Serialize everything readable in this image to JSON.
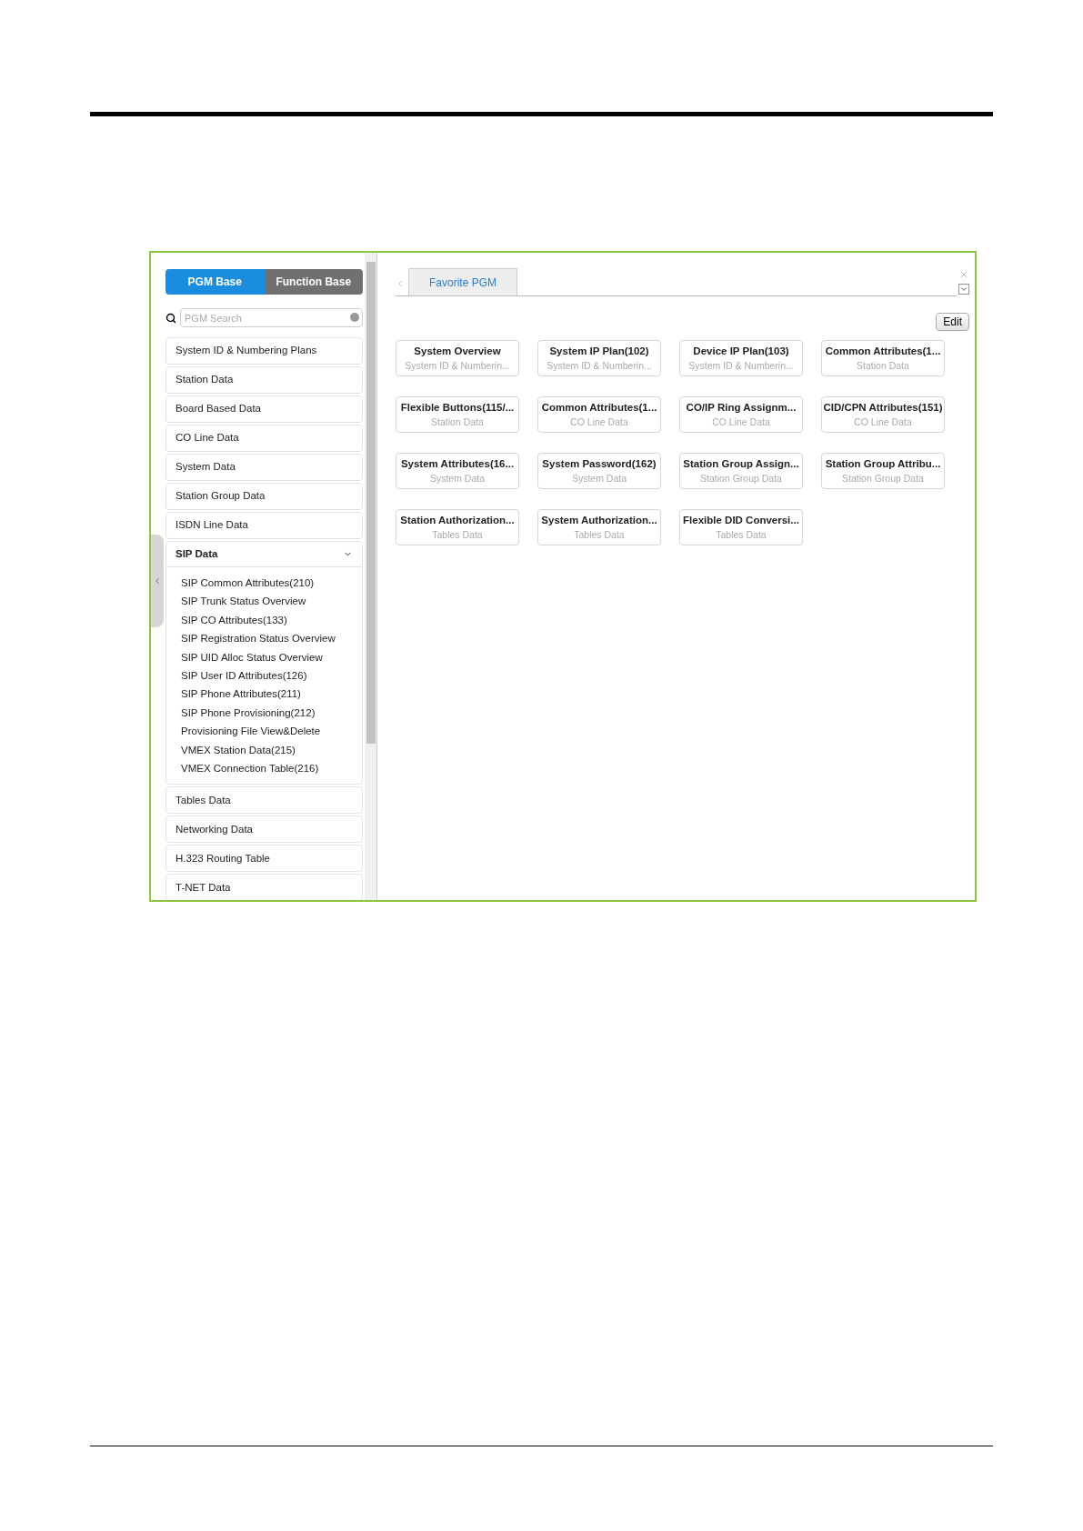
{
  "sidebar": {
    "mode_tabs": [
      {
        "label": "PGM Base",
        "selected": true
      },
      {
        "label": "Function Base",
        "selected": false
      }
    ],
    "search": {
      "placeholder": "PGM Search"
    },
    "items": [
      {
        "label": "System ID & Numbering Plans",
        "expanded": false
      },
      {
        "label": "Station Data",
        "expanded": false
      },
      {
        "label": "Board Based Data",
        "expanded": false
      },
      {
        "label": "CO Line Data",
        "expanded": false
      },
      {
        "label": "System Data",
        "expanded": false
      },
      {
        "label": "Station Group Data",
        "expanded": false
      },
      {
        "label": "ISDN Line Data",
        "expanded": false
      },
      {
        "label": "SIP Data",
        "expanded": true,
        "children": [
          "SIP Common Attributes(210)",
          "SIP Trunk Status Overview",
          "SIP CO Attributes(133)",
          "SIP Registration Status Overview",
          "SIP UID Alloc Status Overview",
          "SIP User ID Attributes(126)",
          "SIP Phone Attributes(211)",
          "SIP Phone Provisioning(212)",
          "Provisioning File View&Delete",
          "VMEX Station Data(215)",
          "VMEX Connection Table(216)"
        ]
      },
      {
        "label": "Tables Data",
        "expanded": false
      },
      {
        "label": "Networking Data",
        "expanded": false
      },
      {
        "label": "H.323 Routing Table",
        "expanded": false
      },
      {
        "label": "T-NET Data",
        "expanded": false
      }
    ]
  },
  "main": {
    "tabs": [
      {
        "label": "Favorite PGM",
        "selected": true
      }
    ],
    "edit_button": "Edit",
    "cards": [
      {
        "title": "System Overview",
        "subtitle": "System ID & Numberin..."
      },
      {
        "title": "System IP Plan(102)",
        "subtitle": "System ID & Numberin..."
      },
      {
        "title": "Device IP Plan(103)",
        "subtitle": "System ID & Numberin..."
      },
      {
        "title": "Common Attributes(1...",
        "subtitle": "Station Data"
      },
      {
        "title": "Flexible Buttons(115/...",
        "subtitle": "Station Data"
      },
      {
        "title": "Common Attributes(1...",
        "subtitle": "CO Line Data"
      },
      {
        "title": "CO/IP Ring Assignm...",
        "subtitle": "CO Line Data"
      },
      {
        "title": "CID/CPN Attributes(151)",
        "subtitle": "CO Line Data"
      },
      {
        "title": "System Attributes(16...",
        "subtitle": "System Data"
      },
      {
        "title": "System Password(162)",
        "subtitle": "System Data"
      },
      {
        "title": "Station Group Assign...",
        "subtitle": "Station Group Data"
      },
      {
        "title": "Station Group Attribu...",
        "subtitle": "Station Group Data"
      },
      {
        "title": "Station Authorization...",
        "subtitle": "Tables Data"
      },
      {
        "title": "System Authorization...",
        "subtitle": "Tables Data"
      },
      {
        "title": "Flexible DID Conversi...",
        "subtitle": "Tables Data"
      }
    ]
  }
}
